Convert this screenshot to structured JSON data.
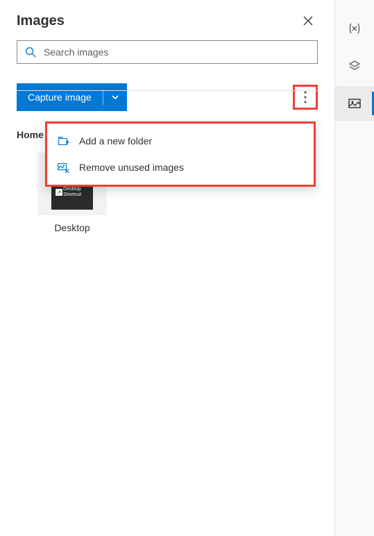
{
  "panel": {
    "title": "Images"
  },
  "search": {
    "placeholder": "Search images",
    "value": ""
  },
  "toolbar": {
    "capture_label": "Capture image"
  },
  "menu": {
    "add_folder": "Add a new folder",
    "remove_unused": "Remove unused images"
  },
  "breadcrumb": {
    "root": "Home"
  },
  "thumbs": [
    {
      "label": "Desktop",
      "inner_text_1": "Desktop",
      "inner_text_2": "Shortcut"
    }
  ],
  "rail": {
    "icons": [
      "variables",
      "layers",
      "images"
    ]
  }
}
